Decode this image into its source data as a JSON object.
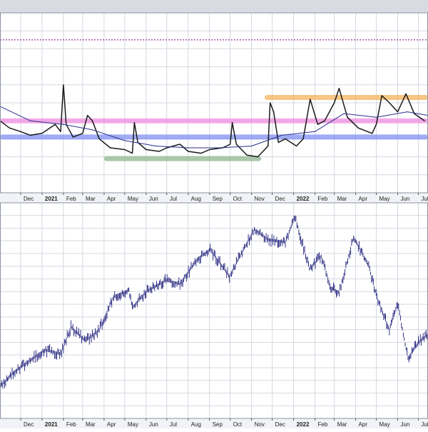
{
  "colors": {
    "background": "#ffffff",
    "header_band": "#d8dbe2",
    "grid": "#d4d8e0",
    "axis_band": "#f1f3f6",
    "panel_border": "#8b93a3",
    "indicator_line": "#1a1a1a",
    "moving_average": "#2b2f8a",
    "price_bars": "#1c1c7a",
    "level_dotted": "#8e1a8e",
    "zone_orange": "#f5b35a",
    "zone_pink": "#ee8fe0",
    "zone_blue": "#7f8ff0",
    "zone_green": "#8fb58f"
  },
  "chart_data": [
    {
      "type": "line",
      "panel": "indicator",
      "x_range": [
        "2020-11-01",
        "2022-07-15"
      ],
      "y_range": [
        0,
        100
      ],
      "grid": true,
      "series": [
        {
          "style": "line",
          "points": [
            [
              "2020-11-01",
              40
            ],
            [
              "2020-11-15",
              36
            ],
            [
              "2020-12-01",
              34
            ],
            [
              "2020-12-15",
              32
            ],
            [
              "2021-01-01",
              33
            ],
            [
              "2021-01-20",
              38
            ],
            [
              "2021-01-28",
              34
            ],
            [
              "2021-02-01",
              60
            ],
            [
              "2021-02-05",
              38
            ],
            [
              "2021-02-15",
              31
            ],
            [
              "2021-03-01",
              33
            ],
            [
              "2021-03-08",
              43
            ],
            [
              "2021-03-15",
              40
            ],
            [
              "2021-03-25",
              30
            ],
            [
              "2021-04-10",
              25
            ],
            [
              "2021-05-01",
              24
            ],
            [
              "2021-05-12",
              22
            ],
            [
              "2021-05-15",
              39
            ],
            [
              "2021-05-20",
              28
            ],
            [
              "2021-06-01",
              24
            ],
            [
              "2021-06-20",
              23
            ],
            [
              "2021-07-01",
              25
            ],
            [
              "2021-07-20",
              27
            ],
            [
              "2021-08-01",
              23
            ],
            [
              "2021-08-20",
              22
            ],
            [
              "2021-09-01",
              24
            ],
            [
              "2021-09-20",
              25
            ],
            [
              "2021-10-01",
              27
            ],
            [
              "2021-10-04",
              39
            ],
            [
              "2021-10-10",
              27
            ],
            [
              "2021-10-25",
              21
            ],
            [
              "2021-11-10",
              20
            ],
            [
              "2021-11-25",
              26
            ],
            [
              "2021-11-28",
              50
            ],
            [
              "2021-12-03",
              45
            ],
            [
              "2021-12-10",
              28
            ],
            [
              "2021-12-20",
              30
            ],
            [
              "2022-01-05",
              26
            ],
            [
              "2022-01-15",
              30
            ],
            [
              "2022-01-25",
              52
            ],
            [
              "2022-02-05",
              38
            ],
            [
              "2022-02-15",
              40
            ],
            [
              "2022-03-01",
              50
            ],
            [
              "2022-03-08",
              58
            ],
            [
              "2022-03-20",
              42
            ],
            [
              "2022-04-05",
              36
            ],
            [
              "2022-04-25",
              33
            ],
            [
              "2022-05-01",
              38
            ],
            [
              "2022-05-09",
              54
            ],
            [
              "2022-05-20",
              50
            ],
            [
              "2022-06-01",
              45
            ],
            [
              "2022-06-13",
              55
            ],
            [
              "2022-06-25",
              44
            ],
            [
              "2022-07-10",
              40
            ]
          ]
        },
        {
          "style": "moving-average",
          "points": [
            [
              "2020-11-01",
              48
            ],
            [
              "2020-12-15",
              40
            ],
            [
              "2021-02-01",
              38
            ],
            [
              "2021-03-15",
              35
            ],
            [
              "2021-05-01",
              29
            ],
            [
              "2021-06-15",
              26
            ],
            [
              "2021-08-01",
              25
            ],
            [
              "2021-09-15",
              25
            ],
            [
              "2021-11-01",
              26
            ],
            [
              "2021-12-15",
              32
            ],
            [
              "2022-02-01",
              34
            ],
            [
              "2022-03-15",
              44
            ],
            [
              "2022-05-01",
              42
            ],
            [
              "2022-06-15",
              45
            ],
            [
              "2022-07-15",
              43
            ]
          ]
        }
      ],
      "reference_lines": [
        {
          "style": "dotted",
          "y": 85
        }
      ],
      "zones": [
        {
          "color": "zone_orange",
          "y": 53,
          "x_from": "2021-11-20",
          "x_to": "2022-07-15"
        },
        {
          "color": "zone_pink",
          "y": 40,
          "x_from": "2020-11-01",
          "x_to": "2022-07-15"
        },
        {
          "color": "zone_blue",
          "y": 31,
          "x_from": "2020-11-01",
          "x_to": "2022-07-15"
        },
        {
          "color": "zone_green",
          "y": 19,
          "x_from": "2021-04-01",
          "x_to": "2021-11-15"
        }
      ]
    },
    {
      "type": "line",
      "panel": "price",
      "x_range": [
        "2020-11-01",
        "2022-07-15"
      ],
      "y_range": [
        3200,
        4900
      ],
      "grid": true,
      "series": [
        {
          "style": "price-bars",
          "points": [
            [
              "2020-11-01",
              3450
            ],
            [
              "2020-11-20",
              3560
            ],
            [
              "2020-12-15",
              3660
            ],
            [
              "2021-01-05",
              3740
            ],
            [
              "2021-01-28",
              3710
            ],
            [
              "2021-02-12",
              3920
            ],
            [
              "2021-03-05",
              3810
            ],
            [
              "2021-03-25",
              3900
            ],
            [
              "2021-04-15",
              4160
            ],
            [
              "2021-05-07",
              4210
            ],
            [
              "2021-05-12",
              4070
            ],
            [
              "2021-06-01",
              4200
            ],
            [
              "2021-06-30",
              4290
            ],
            [
              "2021-07-20",
              4260
            ],
            [
              "2021-08-15",
              4460
            ],
            [
              "2021-09-02",
              4530
            ],
            [
              "2021-09-30",
              4320
            ],
            [
              "2021-10-20",
              4530
            ],
            [
              "2021-11-05",
              4690
            ],
            [
              "2021-11-25",
              4610
            ],
            [
              "2021-12-20",
              4590
            ],
            [
              "2022-01-03",
              4790
            ],
            [
              "2022-01-24",
              4380
            ],
            [
              "2022-02-10",
              4480
            ],
            [
              "2022-02-24",
              4230
            ],
            [
              "2022-03-08",
              4190
            ],
            [
              "2022-03-29",
              4630
            ],
            [
              "2022-04-20",
              4400
            ],
            [
              "2022-05-02",
              4150
            ],
            [
              "2022-05-20",
              3900
            ],
            [
              "2022-06-01",
              4100
            ],
            [
              "2022-06-16",
              3670
            ],
            [
              "2022-07-01",
              3800
            ],
            [
              "2022-07-15",
              3860
            ]
          ]
        }
      ]
    }
  ],
  "axis": {
    "month_labels": [
      {
        "date": "2020-12-01",
        "label": "Dec",
        "bold": false
      },
      {
        "date": "2021-01-01",
        "label": "2021",
        "bold": true
      },
      {
        "date": "2021-02-01",
        "label": "Feb",
        "bold": false
      },
      {
        "date": "2021-03-01",
        "label": "Mar",
        "bold": false
      },
      {
        "date": "2021-04-01",
        "label": "Apr",
        "bold": false
      },
      {
        "date": "2021-05-01",
        "label": "May",
        "bold": false
      },
      {
        "date": "2021-06-01",
        "label": "Jun",
        "bold": false
      },
      {
        "date": "2021-07-01",
        "label": "Jul",
        "bold": false
      },
      {
        "date": "2021-08-01",
        "label": "Aug",
        "bold": false
      },
      {
        "date": "2021-09-01",
        "label": "Sep",
        "bold": false
      },
      {
        "date": "2021-10-01",
        "label": "Oct",
        "bold": false
      },
      {
        "date": "2021-11-01",
        "label": "Nov",
        "bold": false
      },
      {
        "date": "2021-12-01",
        "label": "Dec",
        "bold": false
      },
      {
        "date": "2022-01-01",
        "label": "2022",
        "bold": true
      },
      {
        "date": "2022-02-01",
        "label": "Feb",
        "bold": false
      },
      {
        "date": "2022-03-01",
        "label": "Mar",
        "bold": false
      },
      {
        "date": "2022-04-01",
        "label": "Apr",
        "bold": false
      },
      {
        "date": "2022-05-01",
        "label": "May",
        "bold": false
      },
      {
        "date": "2022-06-01",
        "label": "Jun",
        "bold": false
      },
      {
        "date": "2022-07-01",
        "label": "Jul",
        "bold": false
      }
    ]
  }
}
